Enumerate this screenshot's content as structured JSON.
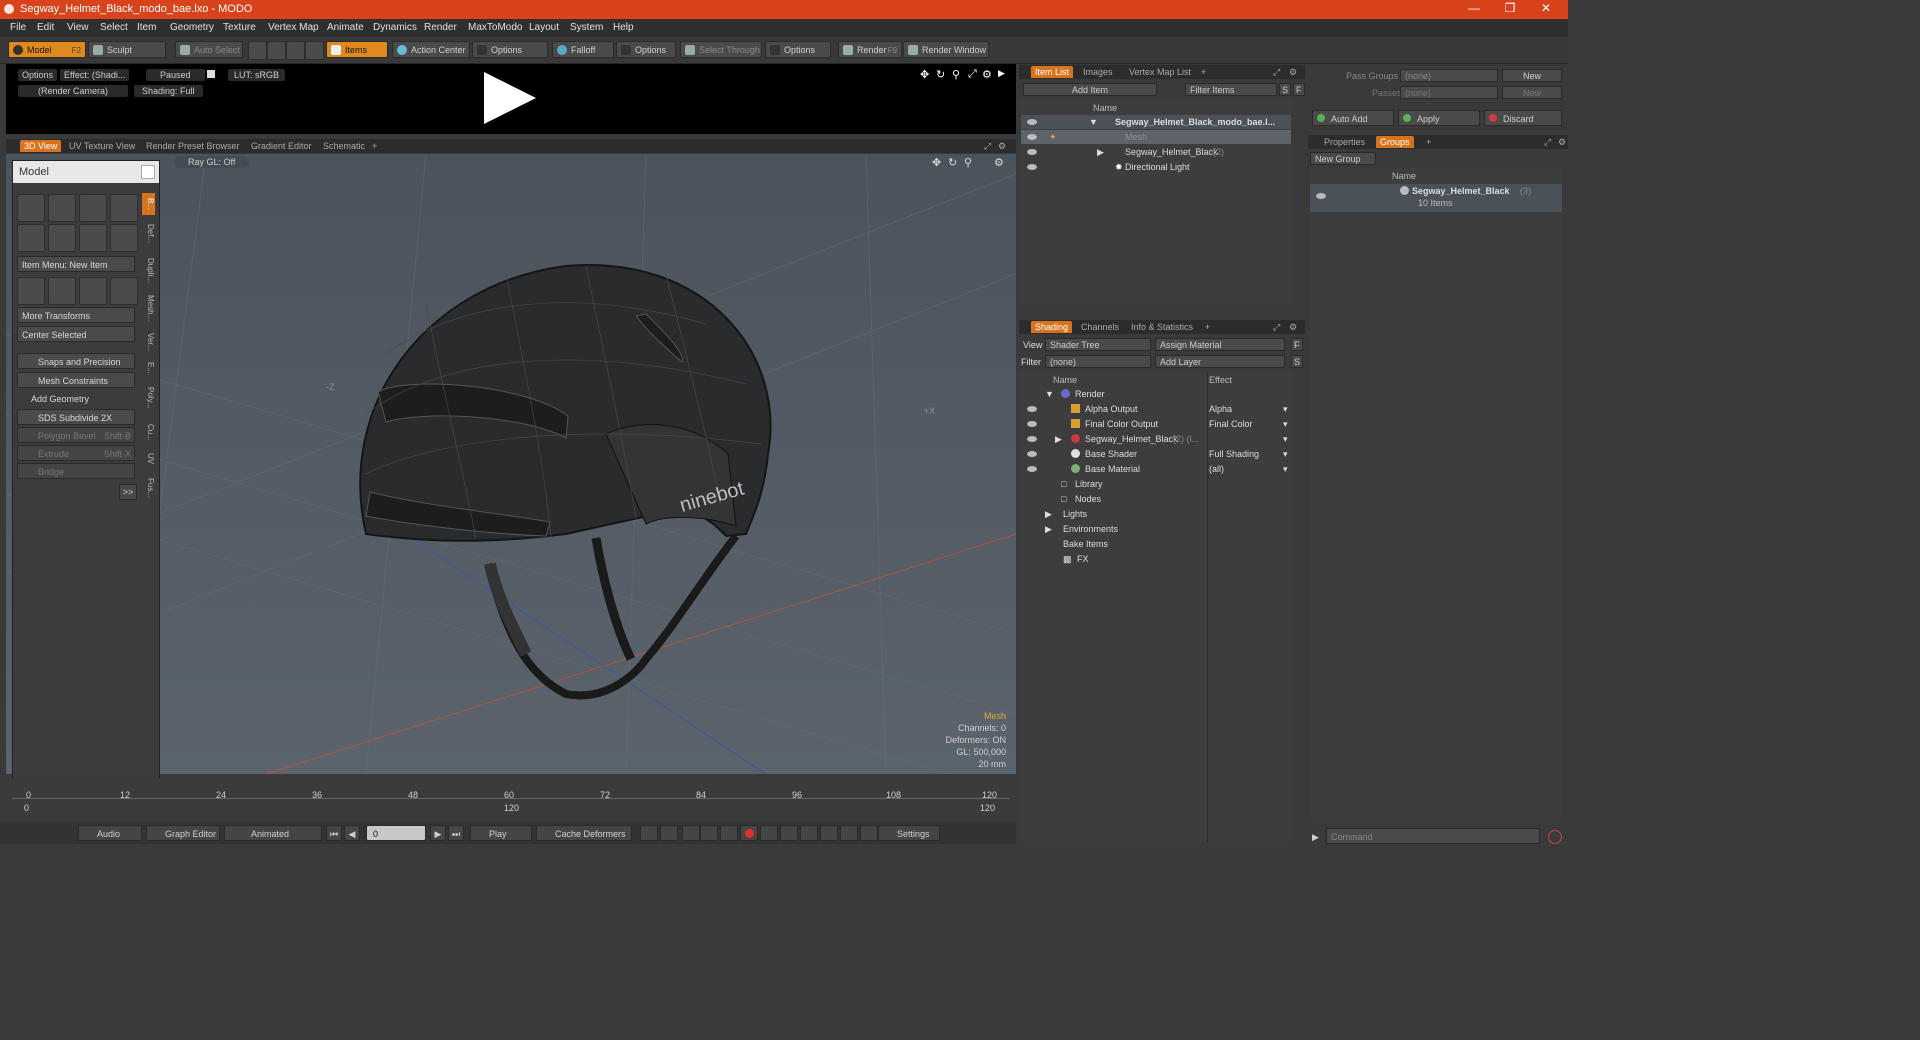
{
  "title": "Segway_Helmet_Black_modo_bae.lxo - MODO",
  "menu": [
    "File",
    "Edit",
    "View",
    "Select",
    "Item",
    "Geometry",
    "Texture",
    "Vertex Map",
    "Animate",
    "Dynamics",
    "Render",
    "MaxToModo",
    "Layout",
    "System",
    "Help"
  ],
  "toolbar": {
    "model": "Model",
    "model_key": "F2",
    "sculpt": "Sculpt",
    "auto_select": "Auto Select",
    "items": "Items",
    "action_center": "Action Center",
    "options1": "Options",
    "falloff": "Falloff",
    "options2": "Options",
    "select_through": "Select Through",
    "options3": "Options",
    "render": "Render",
    "render_key": "F9",
    "render_window": "Render Window"
  },
  "preview": {
    "options": "Options",
    "effect": "Effect: (Shadi...",
    "paused": "Paused",
    "lut": "LUT: sRGB",
    "camera": "(Render Camera)",
    "shading": "Shading: Full"
  },
  "view_tabs": [
    "3D View",
    "UV Texture View",
    "Render Preset Browser",
    "Gradient Editor",
    "Schematic"
  ],
  "viewport": {
    "raygl": "Ray GL: Off",
    "neg_z": "-Z",
    "pos_x": "+X",
    "info_title": "Mesh",
    "channels": "Channels: 0",
    "deformers": "Deformers: ON",
    "gl": "GL: 500,000",
    "scale": "20 mm",
    "brand": "ninebot"
  },
  "model_panel": {
    "title": "Model",
    "item_menu": "Item Menu: New Item",
    "more_transforms": "More Transforms",
    "center_selected": "Center Selected",
    "snaps": "Snaps and Precision",
    "mesh_constraints": "Mesh Constraints",
    "add_geometry": "Add Geometry",
    "sds": "SDS Subdivide 2X",
    "polygon_bevel": "Polygon Bevel",
    "polygon_bevel_key": "Shift-B",
    "extrude": "Extrude",
    "extrude_key": "Shift-X",
    "bridge": "Bridge",
    "more": ">>",
    "vtabs": [
      "B...",
      "Def...",
      "Dupli...",
      "Mesh...",
      "Ver...",
      "E...",
      "Poly...",
      "Cu...",
      "UV",
      "Fus..."
    ]
  },
  "timeline": {
    "ticks": [
      "0",
      "12",
      "24",
      "36",
      "48",
      "60",
      "72",
      "84",
      "96",
      "108",
      "120"
    ],
    "start": "0",
    "mid": "120",
    "end": "120"
  },
  "bottom": {
    "audio": "Audio",
    "graph_editor": "Graph Editor",
    "animated": "Animated",
    "frame": "0",
    "play": "Play",
    "cache": "Cache Deformers",
    "settings": "Settings"
  },
  "item_list": {
    "tabs": [
      "Item List",
      "Images",
      "Vertex Map List"
    ],
    "add_item": "Add Item",
    "filter": "Filter Items",
    "s": "S",
    "f": "F",
    "col_name": "Name",
    "rows": [
      {
        "label": "Segway_Helmet_Black_modo_bae.l...",
        "count": ""
      },
      {
        "label": "Mesh",
        "count": ""
      },
      {
        "label": "Segway_Helmet_Black",
        "count": "(2)"
      },
      {
        "label": "Directional Light",
        "count": ""
      }
    ]
  },
  "shading": {
    "tabs": [
      "Shading",
      "Channels",
      "Info & Statistics"
    ],
    "view_label": "View",
    "view_value": "Shader Tree",
    "assign": "Assign Material",
    "f": "F",
    "filter_label": "Filter",
    "filter_value": "(none)",
    "add_layer": "Add Layer",
    "s": "S",
    "col_name": "Name",
    "col_effect": "Effect",
    "rows": [
      {
        "name": "Render",
        "effect": ""
      },
      {
        "name": "Alpha Output",
        "effect": "Alpha"
      },
      {
        "name": "Final Color Output",
        "effect": "Final Color"
      },
      {
        "name": "Segway_Helmet_Black",
        "count": "(2) (l...",
        "effect": ""
      },
      {
        "name": "Base Shader",
        "effect": "Full Shading"
      },
      {
        "name": "Base Material",
        "effect": "(all)"
      },
      {
        "name": "Library",
        "effect": ""
      },
      {
        "name": "Nodes",
        "effect": ""
      },
      {
        "name": "Lights",
        "effect": ""
      },
      {
        "name": "Environments",
        "effect": ""
      },
      {
        "name": "Bake Items",
        "effect": ""
      },
      {
        "name": "FX",
        "effect": ""
      }
    ]
  },
  "groups": {
    "pass_groups": "Pass Groups",
    "passes": "Passes",
    "none": "(none)",
    "new": "New",
    "auto_add": "Auto Add",
    "apply": "Apply",
    "discard": "Discard",
    "tabs": [
      "Properties",
      "Groups"
    ],
    "new_group": "New Group",
    "col_name": "Name",
    "group_name": "Segway_Helmet_Black",
    "group_count": "(3)",
    "group_items": "10 Items",
    "command": "Command"
  },
  "colors": {
    "accent": "#d7731c",
    "title": "#d8431c"
  }
}
